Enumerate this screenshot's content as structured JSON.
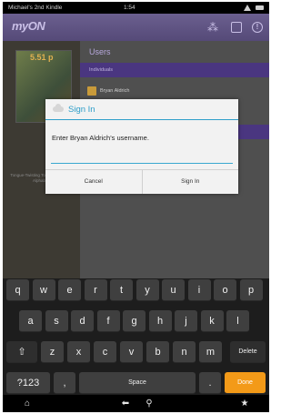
{
  "status_bar": {
    "device_name": "Michael's 2nd Kindle",
    "time": "1:54"
  },
  "app_bar": {
    "logo": "myON",
    "icons": [
      "grid-icon",
      "box-icon",
      "info-icon"
    ]
  },
  "background": {
    "book_title": "5.51 p",
    "book_caption": "Tongue-Twisting Tongue and Taste Alphabets",
    "users_title": "Users",
    "section_individuals": "Individuals",
    "user_name": "Bryan Aldrich"
  },
  "dialog": {
    "title": "Sign In",
    "message": "Enter Bryan Aldrich's username.",
    "cancel_label": "Cancel",
    "sign_in_label": "Sign In",
    "accent_color": "#2e9ec9"
  },
  "keyboard": {
    "row1": [
      "q",
      "w",
      "e",
      "r",
      "t",
      "y",
      "u",
      "i",
      "o",
      "p"
    ],
    "row2": [
      "a",
      "s",
      "d",
      "f",
      "g",
      "h",
      "j",
      "k",
      "l"
    ],
    "row3": [
      "z",
      "x",
      "c",
      "v",
      "b",
      "n",
      "m"
    ],
    "shift_label": "⇧",
    "delete_label": "Delete",
    "numbers_label": "?123",
    "comma_label": ",",
    "space_label": "Space",
    "period_label": ".",
    "done_label": "Done",
    "done_color": "#f39a18"
  },
  "nav_bar": {
    "icons": [
      "home-icon",
      "back-icon",
      "search-icon",
      "favorite-icon"
    ]
  }
}
